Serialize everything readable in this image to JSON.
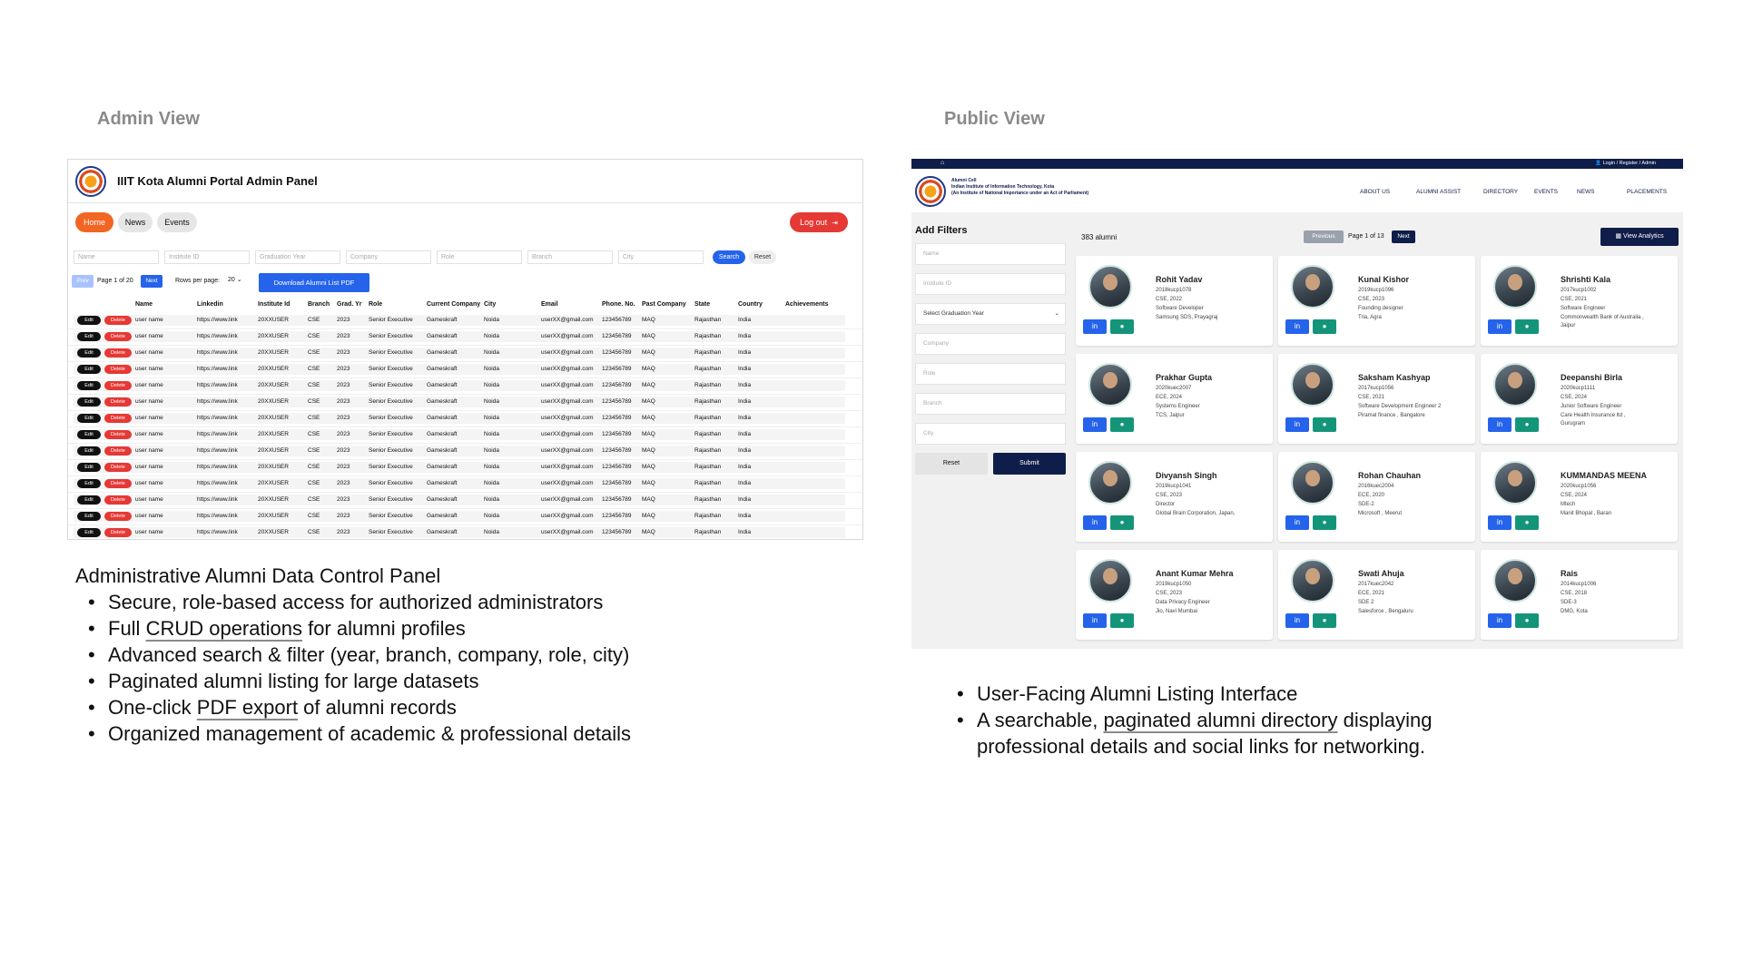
{
  "admin": {
    "section_label": "Admin View",
    "title": "IIIT Kota Alumni Portal Admin Panel",
    "nav": {
      "home": "Home",
      "news": "News",
      "events": "Events",
      "logout": "Log out"
    },
    "filters": {
      "name": "Name",
      "institute_id": "Institute ID",
      "grad_year": "Graduation Year",
      "company": "Company",
      "role": "Role",
      "branch": "Branch",
      "city": "City",
      "search": "Search",
      "reset": "Reset"
    },
    "pagination": {
      "prev": "Prev",
      "page": "Page 1 of 20",
      "next": "Next",
      "rows_label": "Rows per page:",
      "rows_value": "20",
      "download": "Download Alumni List PDF"
    },
    "columns": [
      "Name",
      "Linkedin",
      "Institute Id",
      "Branch",
      "Grad. Yr",
      "Role",
      "Current Company",
      "City",
      "Email",
      "Phone. No.",
      "Past Company",
      "State",
      "Country",
      "Achievements"
    ],
    "row": {
      "edit": "Edit",
      "delete": "Delete",
      "cells": [
        "user name",
        "https://www.link",
        "20XXUSER",
        "CSE",
        "2023",
        "Senior Executive",
        "Gameskraft",
        "Noida",
        "userXX@gmail.com",
        "123456789",
        "MAQ",
        "Rajasthan",
        "India",
        ""
      ]
    },
    "row_count": 14
  },
  "admin_desc": {
    "heading": "Administrative Alumni Data Control Panel",
    "b1": "Secure, role-based access for authorized administrators",
    "b2_pre": "Full ",
    "b2_link": "CRUD operations",
    "b2_post": " for alumni profiles",
    "b3": "Advanced search & filter (year, branch, company, role, city)",
    "b4": "Paginated alumni listing for large datasets",
    "b5_pre": "One-click ",
    "b5_link": "PDF export",
    "b5_post": " of alumni records",
    "b6": "Organized management of academic & professional details"
  },
  "public": {
    "section_label": "Public View",
    "login": "Login / Register / Admin",
    "org": {
      "line1": "Alumni Cell",
      "line2": "Indian Institute of Information Technology, Kota",
      "line3": "(An Institute of National Importance under an Act of Parliament)"
    },
    "nav": [
      "ABOUT US",
      "ALUMNI ASSIST",
      "DIRECTORY",
      "EVENTS",
      "NEWS",
      "PLACEMENTS"
    ],
    "filters": {
      "heading": "Add Filters",
      "name": "Name",
      "institute_id": "Institute ID",
      "grad_year": "Select Graduation Year",
      "company": "Company",
      "role": "Role",
      "branch": "Branch",
      "city": "City",
      "reset": "Reset",
      "submit": "Submit"
    },
    "listing": {
      "count": "383 alumni",
      "previous": "Previous",
      "page": "Page 1 of 13",
      "next": "Next",
      "analytics": "View Analytics"
    },
    "cards": [
      {
        "name": "Rohit Yadav",
        "id": "2018kucp1078",
        "batch": "CSE, 2022",
        "role": "Software Developer",
        "company": "Samsung SDS, Prayagraj"
      },
      {
        "name": "Kunal Kishor",
        "id": "2019kucp1096",
        "batch": "CSE, 2023",
        "role": "Founding designer",
        "company": "Tria, Agra"
      },
      {
        "name": "Shrishti Kala",
        "id": "2017kucp1002",
        "batch": "CSE, 2021",
        "role": "Software Engineer",
        "company": "Commonwealth Bank of Australia ,",
        "company2": "Jaipur"
      },
      {
        "name": "Prakhar Gupta",
        "id": "2020kuec2007",
        "batch": "ECE, 2024",
        "role": "Systems Engineer",
        "company": "TCS, Jaipur"
      },
      {
        "name": "Saksham Kashyap",
        "id": "2017kucp1056",
        "batch": "CSE, 2021",
        "role": "Software Development Engineer 2",
        "company": "Piramal finance , Bangalore"
      },
      {
        "name": "Deepanshi Birla",
        "id": "2020kucp1111",
        "batch": "CSE, 2024",
        "role": "Junior Software Engineer",
        "company": "Care Health Insurance ltd ,",
        "company2": "Gurugram"
      },
      {
        "name": "Divyansh Singh",
        "id": "2019kucp1041",
        "batch": "CSE, 2023",
        "role": "Director",
        "company": "Global Brain Corporation, Japan,"
      },
      {
        "name": "Rohan Chauhan",
        "id": "2016kuec2004",
        "batch": "ECE, 2020",
        "role": "SDE-2",
        "company": "Microsoft , Meerut"
      },
      {
        "name": "KUMMANDAS MEENA",
        "id": "2020kucp1056",
        "batch": "CSE, 2024",
        "role": "Mtech",
        "company": "Manit Bhopal , Baran"
      },
      {
        "name": "Anant Kumar Mehra",
        "id": "2019kucp1050",
        "batch": "CSE, 2023",
        "role": "Data Privacy Engineer",
        "company": "Jio, Navi Mumbai"
      },
      {
        "name": "Swati Ahuja",
        "id": "2017kuec2042",
        "batch": "ECE, 2021",
        "role": "SDE 2",
        "company": "Salesforce , Bengaluru"
      },
      {
        "name": "Rais",
        "id": "2014kucp1006",
        "batch": "CSE, 2018",
        "role": "SDE-3",
        "company": "DMG, Kota"
      }
    ]
  },
  "public_desc": {
    "b1": "User-Facing Alumni Listing Interface",
    "b2_pre": "A searchable, ",
    "b2_link": "paginated alumni directory",
    "b2_post": " displaying professional details and social links for networking."
  },
  "colors": {
    "accent_orange": "#f26522",
    "navy": "#0f1d4a",
    "blue": "#2563eb",
    "teal": "#14957a",
    "red": "#e53935"
  }
}
